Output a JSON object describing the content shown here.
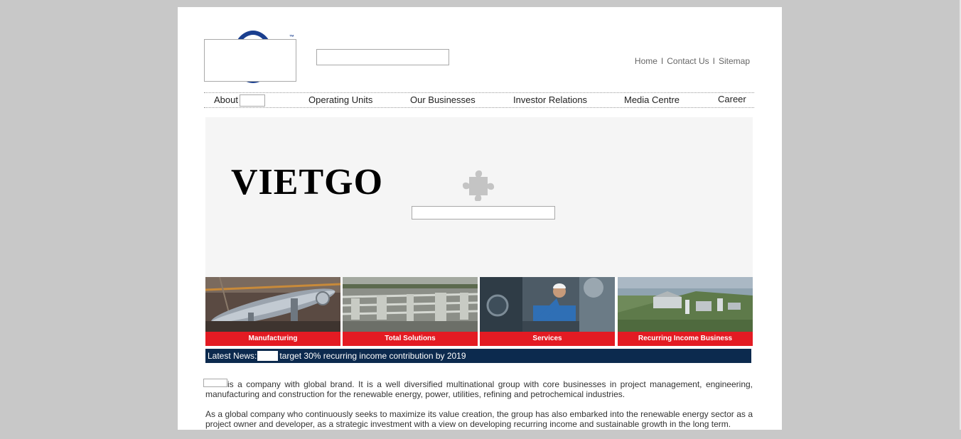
{
  "header": {
    "logo_tm": "™",
    "links": [
      "Home",
      "Contact Us",
      "Sitemap"
    ],
    "link_separator": "I"
  },
  "nav": {
    "items": [
      "About",
      "Operating Units",
      "Our Businesses",
      "Investor Relations",
      "Media Centre",
      "Career"
    ]
  },
  "banner": {
    "brand": "VIETGO",
    "plugin_icon": "puzzle-piece-icon"
  },
  "tiles": [
    {
      "label": "Manufacturing"
    },
    {
      "label": "Total Solutions"
    },
    {
      "label": "Services"
    },
    {
      "label": "Recurring Income Business"
    }
  ],
  "news": {
    "label": "Latest News:",
    "headline": "target 30% recurring income contribution by 2019"
  },
  "body": {
    "paragraph1": "is a company with global brand. It is a well diversified multinational group with core businesses in project management, engineering, manufacturing and construction for the renewable energy, power, utilities, refining and petrochemical industries.",
    "paragraph2": "As a global company who continuously seeks to maximize its value creation, the group has also embarked into the renewable energy sector as a project owner and developer, as a strategic investment with a view on developing recurring income and sustainable growth in the long term."
  },
  "colors": {
    "page_bg": "#c8c8c8",
    "tile_label_bg": "#e31b23",
    "news_bg": "#0c2a4e",
    "logo_blue": "#1a3f8f"
  }
}
